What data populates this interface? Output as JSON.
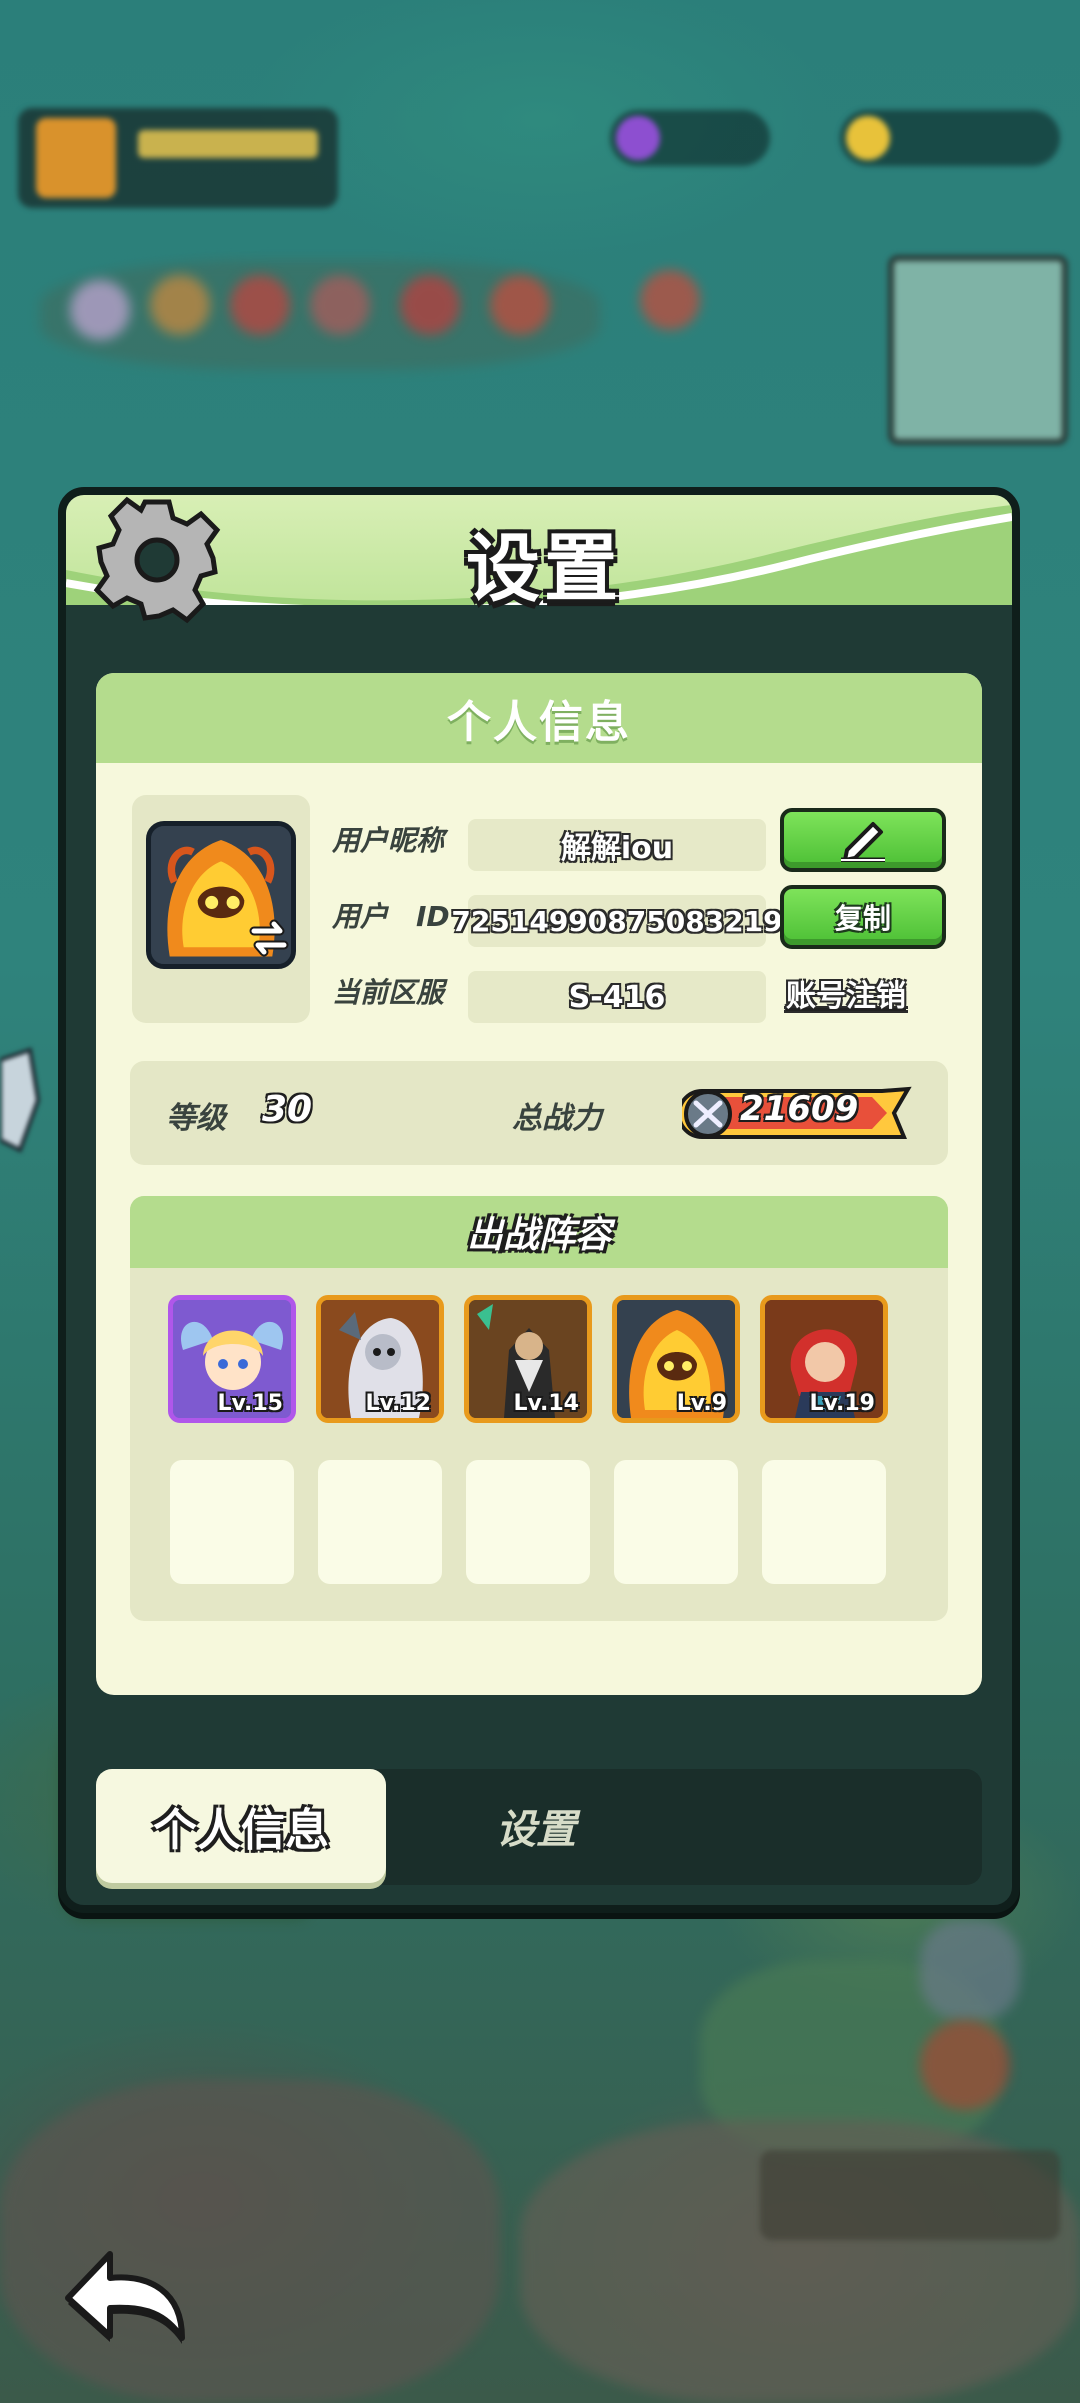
{
  "panel": {
    "title": "设置",
    "gear_icon": "gear-icon"
  },
  "profile": {
    "section_title": "个人信息",
    "nickname_label": "用户昵称",
    "nickname": "解解iou",
    "id_label": "用户　ID",
    "user_id": "72514990875083219",
    "server_label": "当前区服",
    "server": "S-416",
    "edit_icon": "pencil-icon",
    "copy_label": "复制",
    "cancel_account_label": "账号注销",
    "level_label": "等级",
    "level": "30",
    "power_label": "总战力",
    "power": "21609"
  },
  "team": {
    "title": "出战阵容",
    "heroes": [
      {
        "level": "Lv.15",
        "rarity_color": "#b057ea"
      },
      {
        "level": "Lv.12",
        "rarity_color": "#e89a1c"
      },
      {
        "level": "Lv.14",
        "rarity_color": "#e89a1c"
      },
      {
        "level": "Lv.9",
        "rarity_color": "#e89a1c"
      },
      {
        "level": "Lv.19",
        "rarity_color": "#e89a1c"
      }
    ]
  },
  "tabs": {
    "active": "个人信息",
    "inactive": "设置"
  },
  "colors": {
    "header_green": "#bde397",
    "button_green": "#4cbf35",
    "card_bg": "#f6f8dc"
  }
}
